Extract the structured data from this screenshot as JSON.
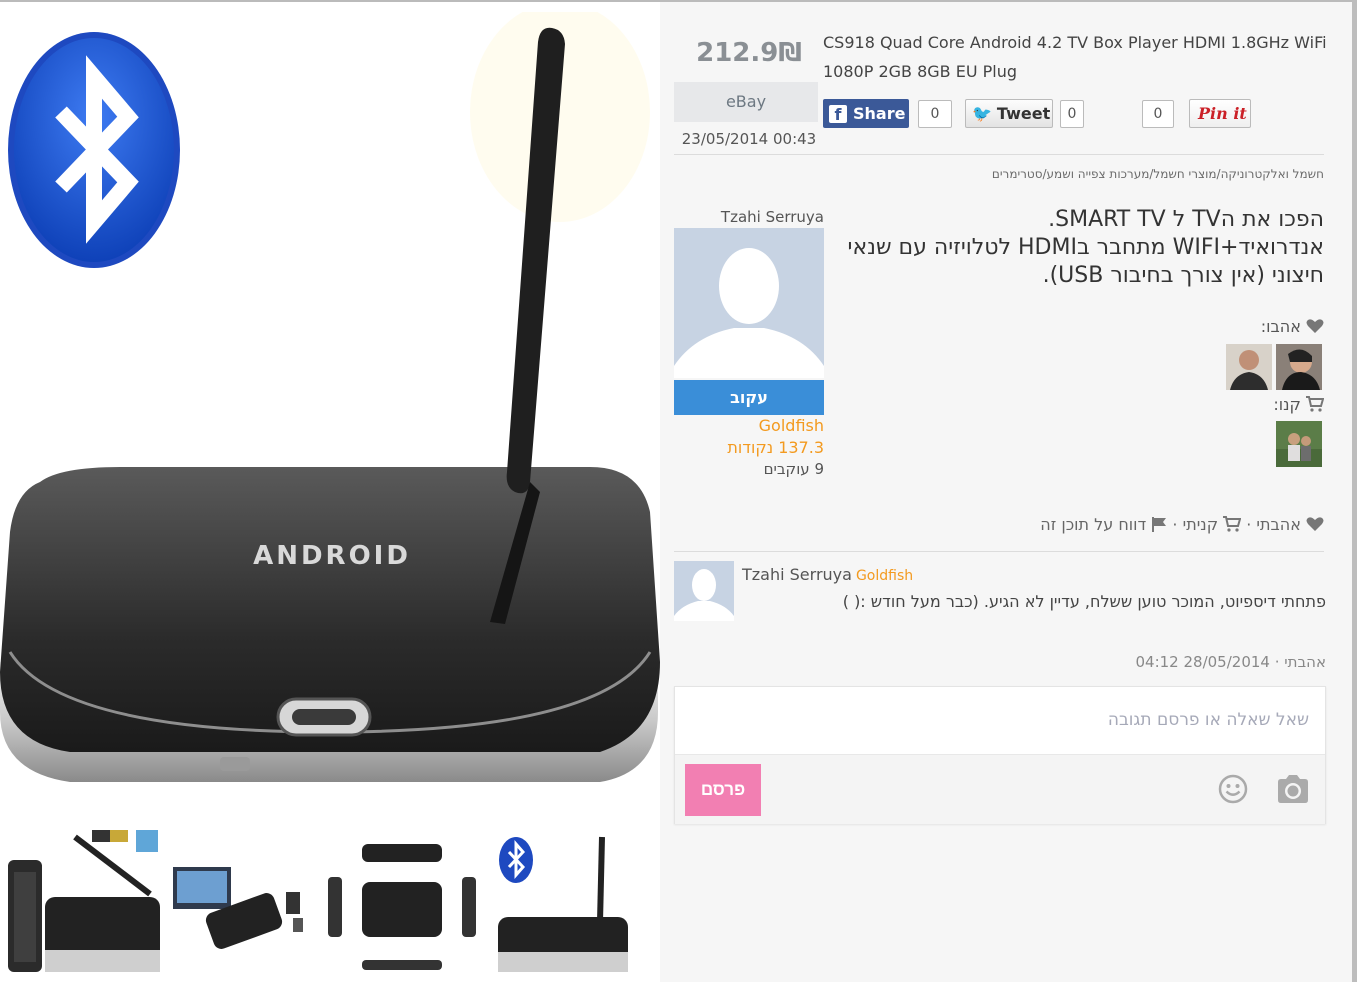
{
  "product": {
    "price": "212.9₪",
    "store": "eBay",
    "date": "23/05/2014 00:43",
    "title": "CS918 Quad Core Android 4.2 TV Box Player HDMI 1.8GHz WiFi 1080P 2GB 8GB EU Plug",
    "brand_text": "ANDROID"
  },
  "social": {
    "share_label": "Share",
    "share_count": "0",
    "tweet_label": "Tweet",
    "tweet_count": "0",
    "pin_label": "Pin it",
    "pin_count": "0"
  },
  "breadcrumb": "חשמל ואלקטרוניקה/מוצרי חשמל/מערכות צפייה ושמע/סטרימרים",
  "user": {
    "name": "Tzahi Serruya",
    "follow_label": "עקוב",
    "level": "Goldfish",
    "points": "137.3 נקודות",
    "followers": "9 עוקבים"
  },
  "description": "הפכו את הTV ל SMART TV.\nאנדרואיד+WIFI מתחבר בHDMI לטלויזיה עם שנאי חיצוני (אין צורך בחיבור USB).",
  "labels": {
    "liked": "אהבו:",
    "bought": "קנו:"
  },
  "actions": {
    "like": "אהבתי",
    "bought": "קניתי",
    "report": "דווח על תוכן זה",
    "sep": " · "
  },
  "comment": {
    "author": "Tzahi Serruya",
    "level": "Goldfish",
    "text": "פתחתי דיספיוט, המוכר טוען ששלח, עדיין לא הגיע. (כבר מעל חודש :( )",
    "like": "אהבתי",
    "date": "28/05/2014 04:12"
  },
  "compose": {
    "placeholder": "שאל שאלה או פרסם תגובה",
    "publish_label": "פרסם"
  },
  "colors": {
    "facebook": "#3b5998",
    "follow": "#3a8ed8",
    "level": "#f39a1f",
    "publish": "#f27fb2",
    "pinterest": "#cb2027"
  },
  "icons": [
    "heart-icon",
    "cart-icon",
    "flag-icon",
    "camera-icon",
    "emoji-icon",
    "bluetooth-icon",
    "facebook-icon",
    "twitter-icon"
  ]
}
